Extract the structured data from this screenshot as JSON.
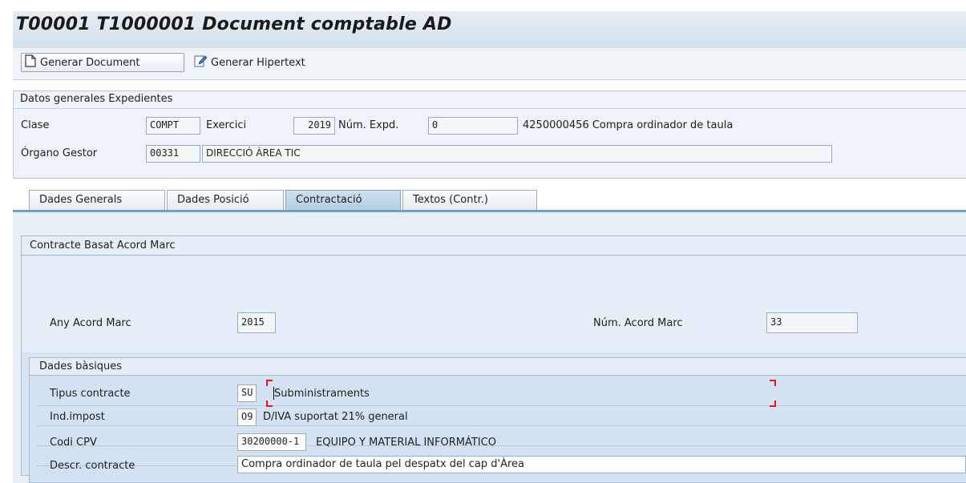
{
  "window": {
    "title": "T00001 T1000001 Document comptable AD"
  },
  "toolbar": {
    "generate_document": "Generar Document",
    "generate_hypertext": "Generar Hipertext"
  },
  "general_group": {
    "title": "Datos generales Expedientes",
    "clase_label": "Clase",
    "clase_value": "COMPT",
    "exercici_label": "Exercici",
    "exercici_value": "2019",
    "num_expd_label": "Núm. Expd.",
    "num_expd_value": "0",
    "expedient_description": "4250000456 Compra ordinador de taula",
    "organo_label": "Órgano Gestor",
    "organo_code": "00331",
    "organo_name": "DIRECCIÓ ÀREA TIC"
  },
  "tabs": [
    {
      "label": "Dades Generals",
      "active": false
    },
    {
      "label": "Dades Posició",
      "active": false
    },
    {
      "label": "Contractació",
      "active": true
    },
    {
      "label": "Textos (Contr.)",
      "active": false
    }
  ],
  "acord_group": {
    "title": "Contracte Basat Acord Marc",
    "any_label": "Any Acord Marc",
    "any_value": "2015",
    "num_label": "Núm. Acord Marc",
    "num_value": "33"
  },
  "basic_group": {
    "title": "Dades bàsiques",
    "tipus_label": "Tipus contracte",
    "tipus_code": "SU",
    "tipus_text": "Subministraments",
    "impost_label": "Ind.impost",
    "impost_code": "O9",
    "impost_text": "D/IVA suportat 21% general",
    "cpv_label": "Codi CPV",
    "cpv_code": "30200000-1",
    "cpv_text": "EQUIPO Y MATERIAL INFORMÁTICO",
    "descr_label": "Descr. contracte",
    "descr_value": "Compra ordinador de taula pel despatx del cap d'Àrea"
  },
  "colors": {
    "title_bg": "#d4e1ec",
    "active_tab": "#b4cde2",
    "group_bg": "#d2e2f0",
    "focus_corner": "#ee1111"
  }
}
